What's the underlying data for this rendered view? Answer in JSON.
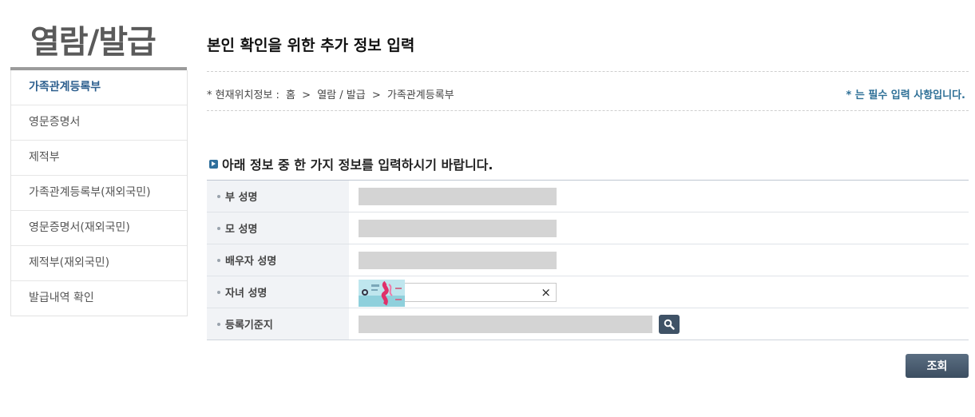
{
  "sidebar": {
    "title": "열람/발급",
    "items": [
      {
        "label": "가족관계등록부",
        "active": true
      },
      {
        "label": "영문증명서",
        "active": false
      },
      {
        "label": "제적부",
        "active": false
      },
      {
        "label": "가족관계등록부(재외국민)",
        "active": false
      },
      {
        "label": "영문증명서(재외국민)",
        "active": false
      },
      {
        "label": "제적부(재외국민)",
        "active": false
      },
      {
        "label": "발급내역 확인",
        "active": false
      }
    ]
  },
  "main": {
    "title": "본인 확인을 위한 추가 정보 입력",
    "location": {
      "prefix": "* 현재위치정보 :",
      "path": [
        "홈",
        "열람 / 발급",
        "가족관계등록부"
      ],
      "separator": ">"
    },
    "required_note": "* 는 필수 입력 사항입니다.",
    "section_title": "아래 정보 중 한 가지 정보를 입력하시기 바랍니다.",
    "form": {
      "father_label": "부 성명",
      "father_value": "",
      "mother_label": "모 성명",
      "mother_value": "",
      "spouse_label": "배우자 성명",
      "spouse_value": "",
      "child_label": "자녀 성명",
      "child_clear": "×",
      "registry_label": "등록기준지",
      "registry_value": ""
    },
    "submit_label": "조회"
  },
  "colors": {
    "accent": "#2d6f96",
    "active_menu": "#2d5f8e",
    "button": "#3f5266",
    "input_disabled": "#d4d4d4"
  },
  "icons": {
    "section_bullet": "arrow-bullet-icon",
    "search": "magnifier-icon",
    "clear": "close-icon"
  }
}
